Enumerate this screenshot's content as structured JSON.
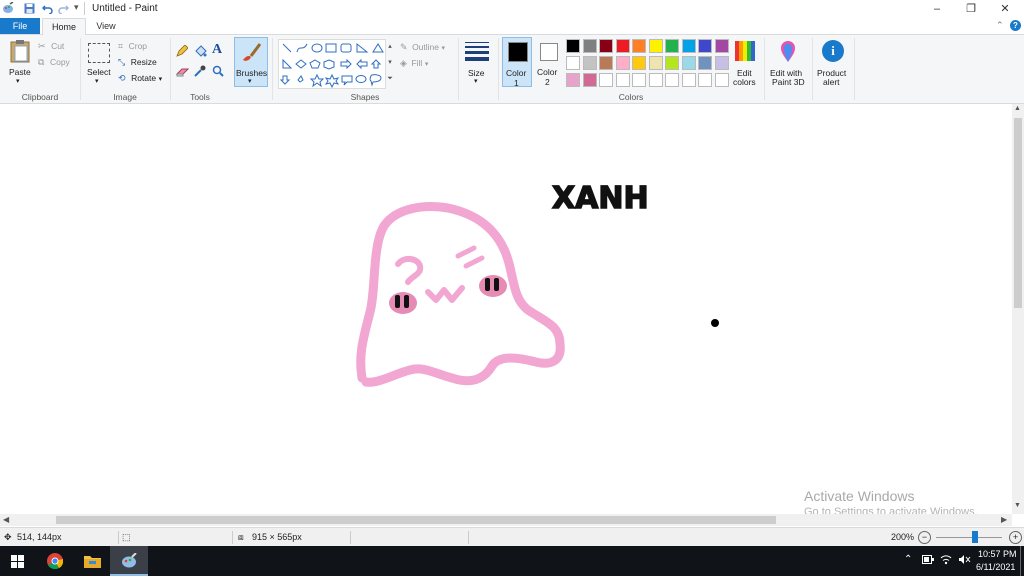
{
  "window": {
    "title": "Untitled - Paint",
    "controls": {
      "minimize": "–",
      "restore": "❐",
      "close": "✕"
    }
  },
  "tabs": {
    "file": "File",
    "home": "Home",
    "view": "View"
  },
  "ribbon": {
    "clipboard": {
      "paste": "Paste",
      "cut": "Cut",
      "copy": "Copy",
      "group": "Clipboard"
    },
    "image": {
      "select": "Select",
      "crop": "Crop",
      "resize": "Resize",
      "rotate": "Rotate",
      "group": "Image"
    },
    "tools": {
      "group": "Tools",
      "text_tool": "A"
    },
    "brushes": {
      "label": "Brushes"
    },
    "shapes": {
      "outline": "Outline",
      "fill": "Fill",
      "group": "Shapes"
    },
    "size": {
      "label": "Size"
    },
    "colors": {
      "color1": "Color\n1",
      "color1_line1": "Color",
      "color1_line2": "1",
      "color2_line1": "Color",
      "color2_line2": "2",
      "color1_value": "#000000",
      "color2_value": "#ffffff",
      "edit_colors_line1": "Edit",
      "edit_colors_line2": "colors",
      "group": "Colors",
      "palette_row1": [
        "#000000",
        "#7f7f7f",
        "#880015",
        "#ed1c24",
        "#ff7f27",
        "#fff200",
        "#22b14c",
        "#00a2e8",
        "#3f48cc",
        "#a349a4"
      ],
      "palette_row2": [
        "#ffffff",
        "#c3c3c3",
        "#b97a57",
        "#ffaec9",
        "#ffc90e",
        "#efe4b0",
        "#b5e61d",
        "#99d9ea",
        "#7092be",
        "#c8bfe7"
      ],
      "palette_row3": [
        "#e7a3c9",
        "#d36a94",
        "#ffffff",
        "#ffffff",
        "#ffffff",
        "#ffffff",
        "#ffffff",
        "#ffffff",
        "#ffffff",
        "#ffffff"
      ]
    },
    "paint3d": {
      "line1": "Edit with",
      "line2": "Paint 3D"
    },
    "product_alert": {
      "line1": "Product",
      "line2": "alert"
    }
  },
  "canvas": {
    "drawn_text": "XANH"
  },
  "watermark": {
    "title": "Activate Windows",
    "subtitle": "Go to Settings to activate Windows."
  },
  "status": {
    "cursor_pos": "514, 144px",
    "canvas_size": "915 × 565px",
    "zoom": "200%",
    "zoom_level": 0.5
  },
  "taskbar": {
    "time": "10:57 PM",
    "date": "6/11/2021"
  }
}
